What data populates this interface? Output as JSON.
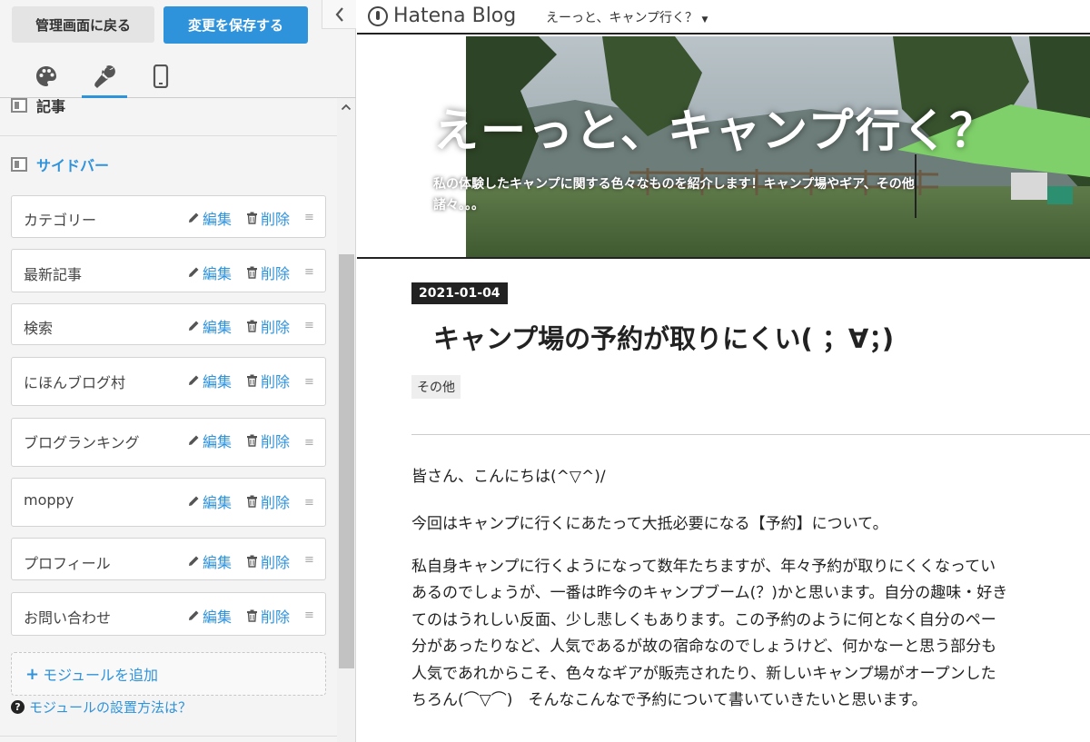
{
  "editor": {
    "back_label": "管理画面に戻る",
    "save_label": "変更を保存する",
    "sections": {
      "article_label": "記事",
      "sidebar_label": "サイドバー"
    },
    "modules": [
      {
        "name": "カテゴリー",
        "edit": "編集",
        "delete": "削除"
      },
      {
        "name": "最新記事",
        "edit": "編集",
        "delete": "削除"
      },
      {
        "name": "検索",
        "edit": "編集",
        "delete": "削除"
      },
      {
        "name": "にほんブログ村",
        "edit": "編集",
        "delete": "削除"
      },
      {
        "name": "ブログランキング",
        "edit": "編集",
        "delete": "削除"
      },
      {
        "name": "moppy",
        "edit": "編集",
        "delete": "削除"
      },
      {
        "name": "プロフィール",
        "edit": "編集",
        "delete": "削除"
      },
      {
        "name": "お問い合わせ",
        "edit": "編集",
        "delete": "削除"
      }
    ],
    "add_module_label": "モジュールを追加",
    "help_label": "モジュールの設置方法は？"
  },
  "preview": {
    "logo_text": "Hatena Blog",
    "blog_name_menu": "えーっと、キャンプ行く？",
    "header_title": "えーっと、キャンプ行く？",
    "header_desc_line1": "私の体験したキャンプに関する色々なものを紹介します！キャンプ場やギア、その他",
    "header_desc_line2": "諸々。。。",
    "date": "2021-01-04",
    "article_title": "キャンプ場の予約が取りにくい( ；∀；)",
    "category": "その他",
    "para1": "皆さん、こんにちは(^▽^)/",
    "para2": "今回はキャンプに行くにあたって大抵必要になる【予約】について。",
    "para3_lines": [
      "私自身キャンプに行くようになって数年たちますが、年々予約が取りにくくなってい",
      "あるのでしょうが、一番は昨今のキャンプブーム(？)かと思います。自分の趣味・好き",
      "てのはうれしい反面、少し悲しくもあります。この予約のように何となく自分のペー",
      "分があったりなど、人気であるが故の宿命なのでしょうけど、何かなーと思う部分も",
      "人気であれからこそ、色々なギアが販売されたり、新しいキャンプ場がオープンした",
      "ちろん(⌒▽⌒)　そんなこんなで予約について書いていきたいと思います。"
    ]
  },
  "colors": {
    "accent": "#2f93dc",
    "header_border": "#222222"
  },
  "icons": [
    "palette-icon",
    "wrench-icon",
    "smartphone-icon",
    "pencil-icon",
    "trash-icon",
    "drag-handle-icon",
    "plus-icon",
    "question-circle-icon",
    "chevron-left-icon",
    "chevron-up-icon",
    "caret-down-icon"
  ]
}
